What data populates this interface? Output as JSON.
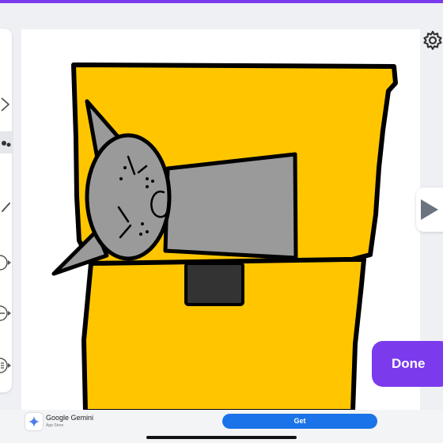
{
  "app": {
    "accent_color": "#7c3aed",
    "tools": [
      {
        "icon": "shape-icon"
      },
      {
        "icon": "fill-bucket-icon",
        "active": true
      },
      {
        "icon": "brush-icon"
      },
      {
        "icon": "dropdown-tool-icon"
      },
      {
        "icon": "sticker-tool-icon"
      },
      {
        "icon": "text-tool-icon"
      }
    ],
    "settings_icon": "gear-icon",
    "next_icon": "play-arrow-icon",
    "done_label": "Done"
  },
  "drawing": {
    "subject": "cat-in-box",
    "box_color": "#ffc600",
    "cat_color": "#999999",
    "outline_color": "#000000"
  },
  "ad": {
    "title": "Google Gemini",
    "subtitle": "App Store",
    "button_label": "Get",
    "button_color": "#1a73e8"
  }
}
